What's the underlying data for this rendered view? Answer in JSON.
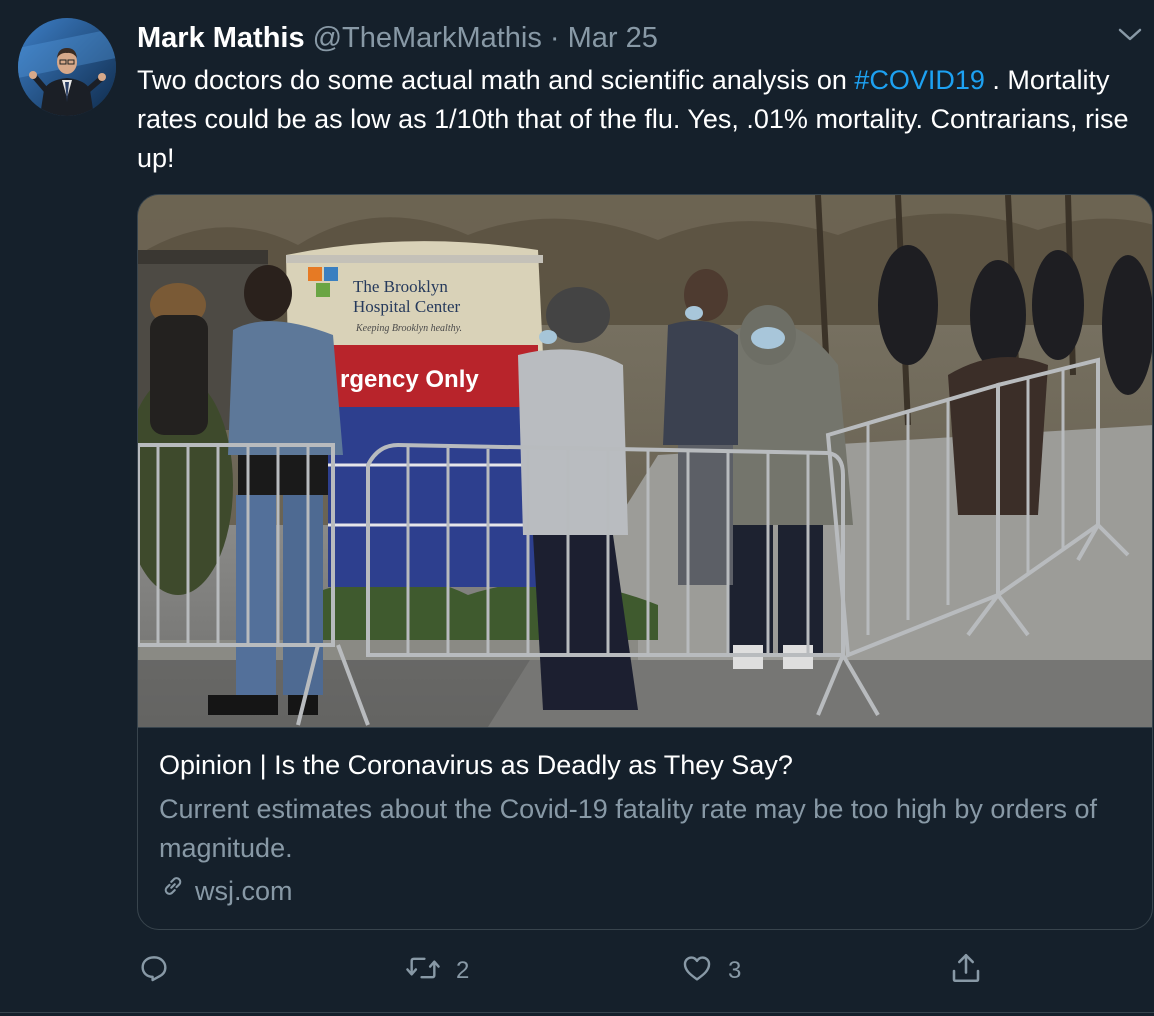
{
  "tweet": {
    "author_name": "Mark Mathis",
    "handle": "@TheMarkMathis",
    "separator": "·",
    "date": "Mar 25",
    "text_before": "Two doctors do some actual math and scientific analysis on ",
    "hashtag": "#COVID19",
    "text_after": " . Mortality rates could be as low as 1/10th that of the flu. Yes, .01% mortality. Contrarians, rise up!"
  },
  "card": {
    "image_sign_name": "The Brooklyn Hospital Center",
    "image_sign_line1": "The Brooklyn",
    "image_sign_line2": "Hospital Center",
    "image_sign_tagline": "Keeping Brooklyn healthy.",
    "image_sign_banner": "rgency Only",
    "title": "Opinion | Is the Coronavirus as Deadly as They Say?",
    "description": "Current estimates about the Covid-19 fatality rate may be too high by orders of magnitude.",
    "domain": "wsj.com"
  },
  "actions": {
    "reply_count": "",
    "retweet_count": "2",
    "like_count": "3"
  },
  "icons": {
    "reply": "reply-icon",
    "retweet": "retweet-icon",
    "like": "heart-icon",
    "share": "share-icon",
    "link": "link-icon",
    "menu": "chevron-down-icon"
  },
  "colors": {
    "background": "#15202b",
    "accent": "#1da1f2",
    "secondary_text": "#8899a6",
    "border": "#38444d"
  }
}
